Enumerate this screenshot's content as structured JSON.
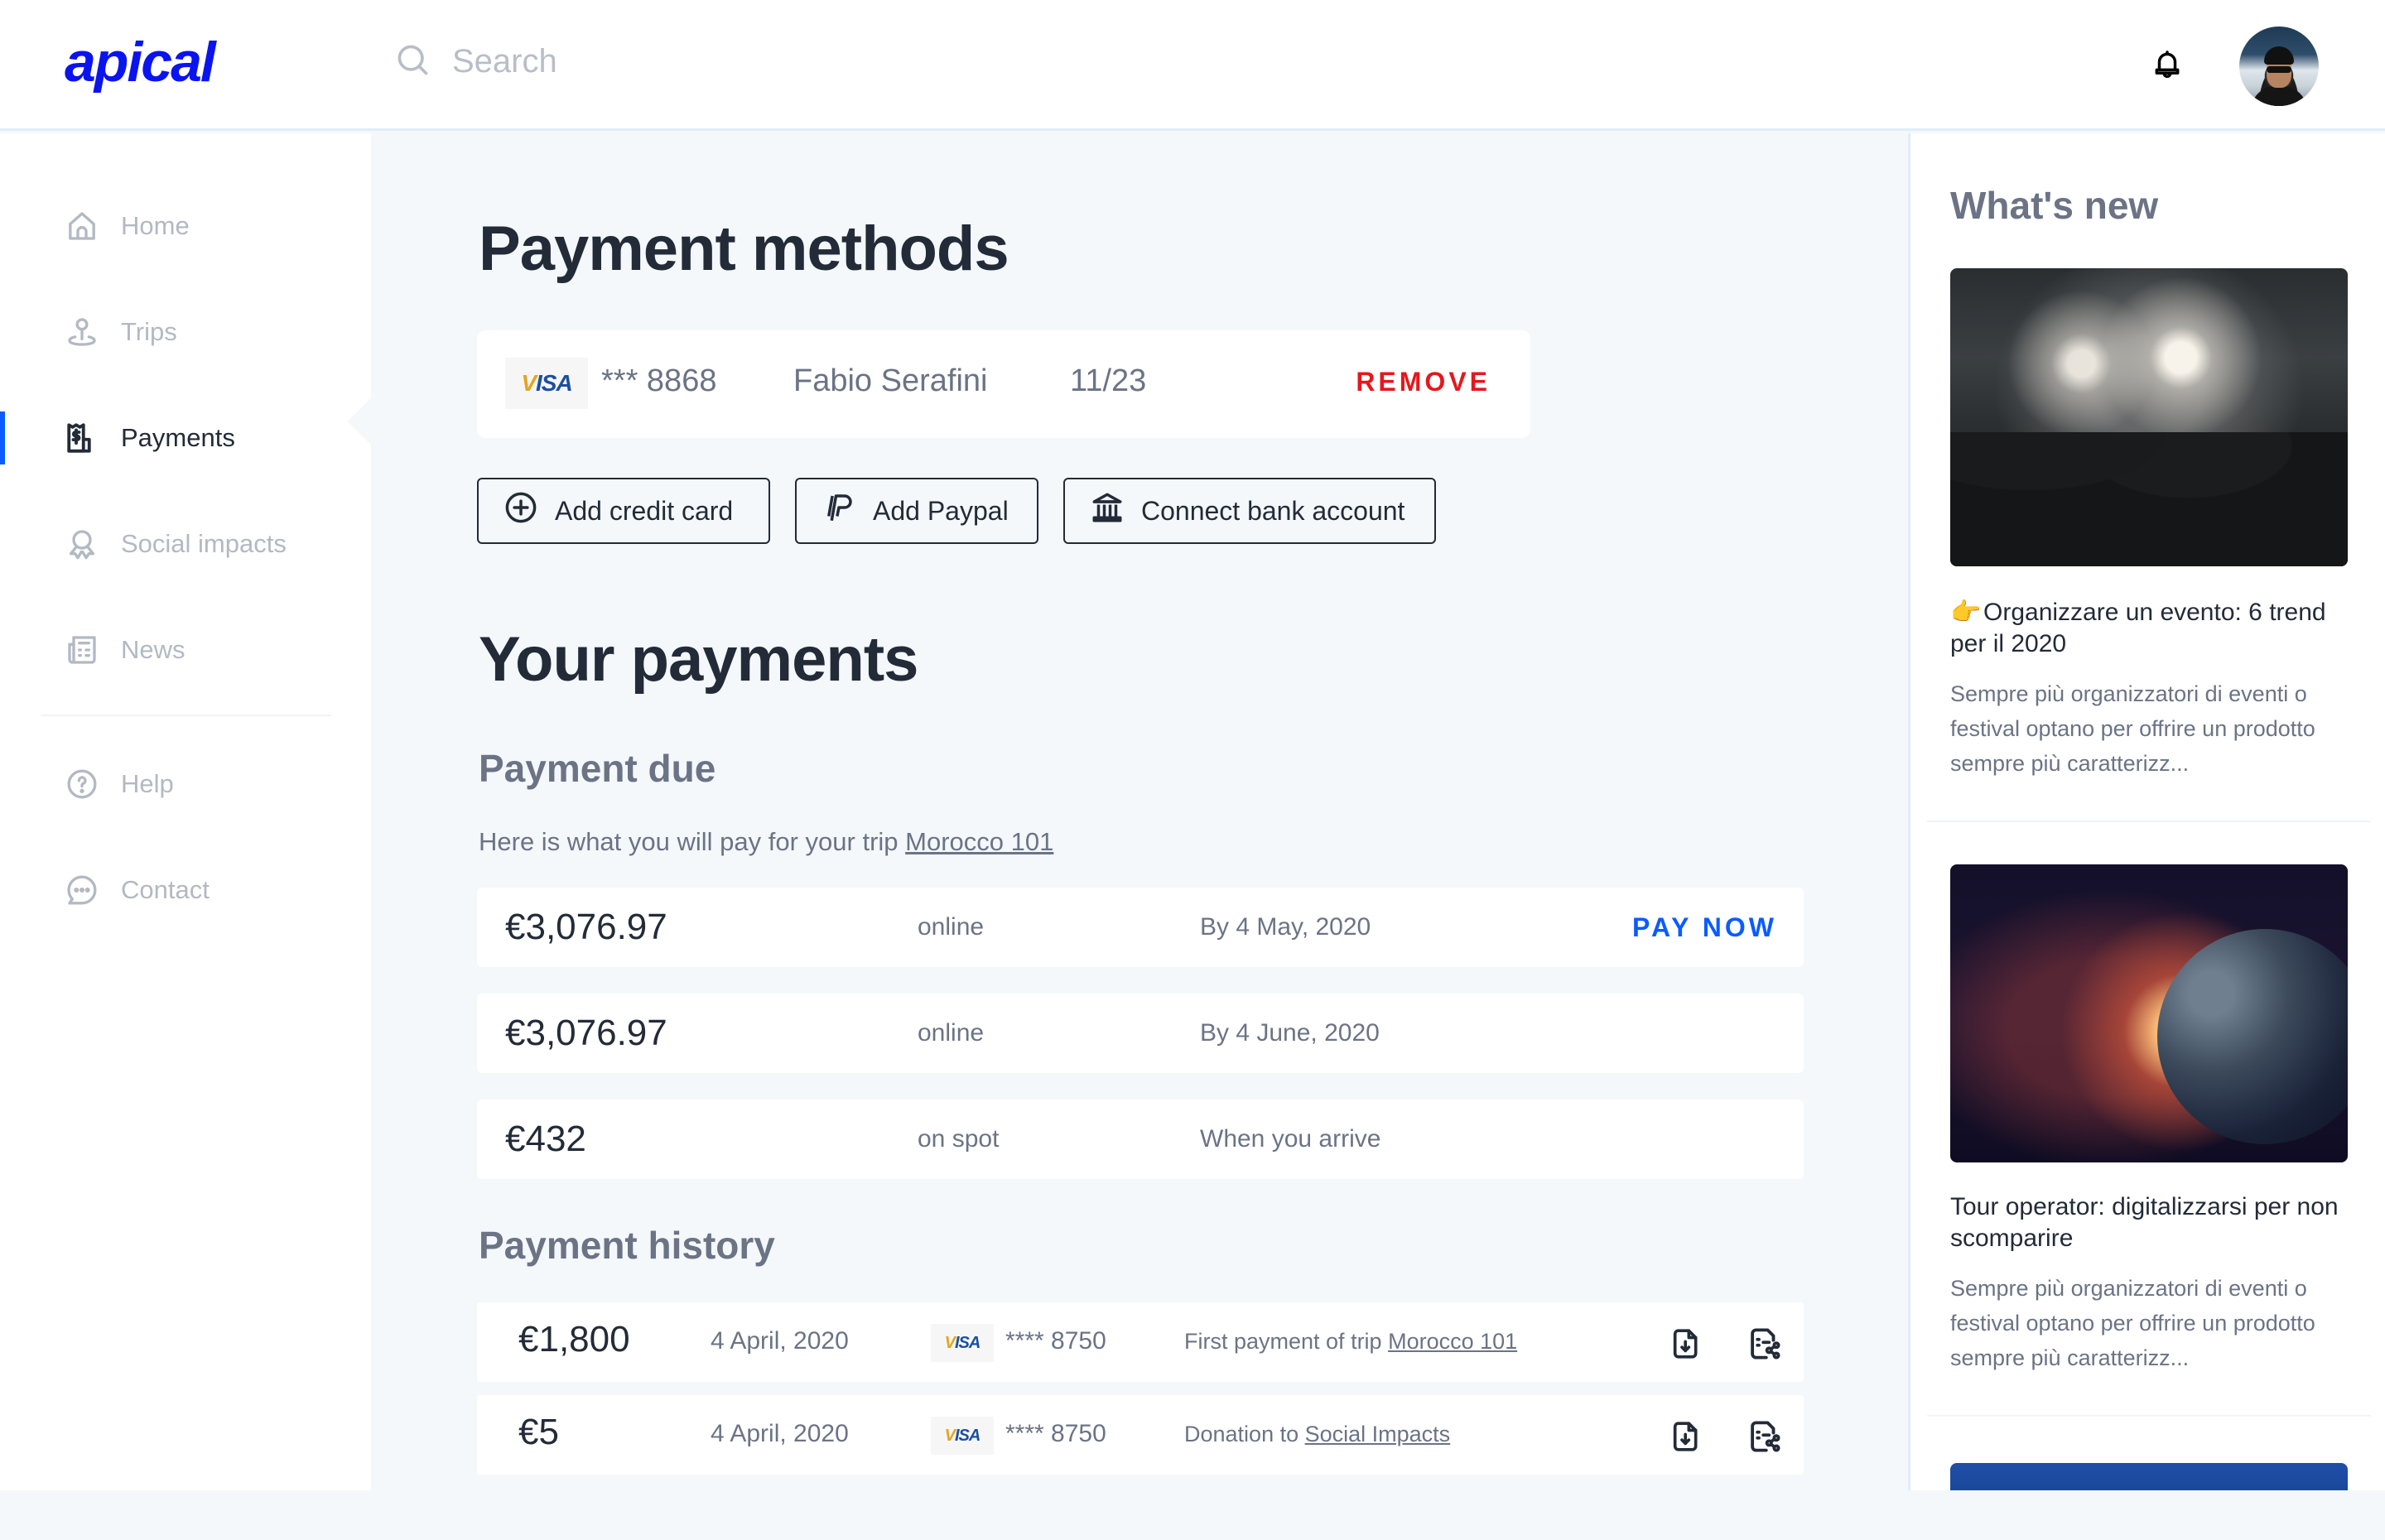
{
  "header": {
    "logo": "apical",
    "search_placeholder": "Search",
    "bell_icon": "bell-icon",
    "avatar_alt": "User avatar"
  },
  "sidebar": {
    "items": [
      {
        "label": "Home",
        "icon": "home-icon",
        "active": false
      },
      {
        "label": "Trips",
        "icon": "map-pin-icon",
        "active": false
      },
      {
        "label": "Payments",
        "icon": "receipt-dollar-icon",
        "active": true
      },
      {
        "label": "Social impacts",
        "icon": "award-icon",
        "active": false
      },
      {
        "label": "News",
        "icon": "newspaper-icon",
        "active": false
      },
      {
        "label": "Help",
        "icon": "help-circle-icon",
        "active": false
      },
      {
        "label": "Contact",
        "icon": "chat-bubble-icon",
        "active": false
      }
    ]
  },
  "main": {
    "payment_methods_title": "Payment methods",
    "method": {
      "brand": "VISA",
      "number": "*** 8868",
      "holder": "Fabio Serafini",
      "expiry": "11/23",
      "remove_label": "REMOVE"
    },
    "buttons": {
      "add_card": "Add credit card",
      "add_paypal": "Add Paypal",
      "connect_bank": "Connect bank account"
    },
    "your_payments_title": "Your payments",
    "payment_due": {
      "title": "Payment due",
      "subtext": "Here is what you will pay for your trip ",
      "trip_link": "Morocco 101",
      "rows": [
        {
          "amount": "€3,076.97",
          "method": "online",
          "due": "By 4 May, 2020",
          "action": "PAY NOW"
        },
        {
          "amount": "€3,076.97",
          "method": "online",
          "due": "By 4 June, 2020",
          "action": ""
        },
        {
          "amount": "€432",
          "method": "on spot",
          "due": "When you arrive",
          "action": ""
        }
      ]
    },
    "payment_history": {
      "title": "Payment history",
      "rows": [
        {
          "amount": "€1,800",
          "date": "4 April, 2020",
          "brand": "VISA",
          "card": "**** 8750",
          "desc": "First payment of trip ",
          "desc_link": "Morocco 101"
        },
        {
          "amount": "€5",
          "date": "4 April, 2020",
          "brand": "VISA",
          "card": "**** 8750",
          "desc": "Donation to ",
          "desc_link": "Social Impacts"
        }
      ]
    }
  },
  "whats_new": {
    "title": "What's new",
    "articles": [
      {
        "emoji": "👉",
        "title": "Organizzare un evento: 6 trend per il 2020",
        "body": "Sempre più organizzatori di eventi o festival optano per offrire un prodotto sempre più caratterizz..."
      },
      {
        "emoji": "",
        "title": "Tour operator: digitalizzarsi per non scomparire",
        "body": "Sempre più organizzatori di eventi o festival optano per offrire un prodotto sempre più caratterizz..."
      }
    ]
  },
  "colors": {
    "brand": "#0a14f0",
    "accent": "#0a5cff",
    "danger": "#e5181d",
    "text_dark": "#232b38",
    "text_muted": "#6b7385",
    "bg": "#f4f8fb"
  }
}
